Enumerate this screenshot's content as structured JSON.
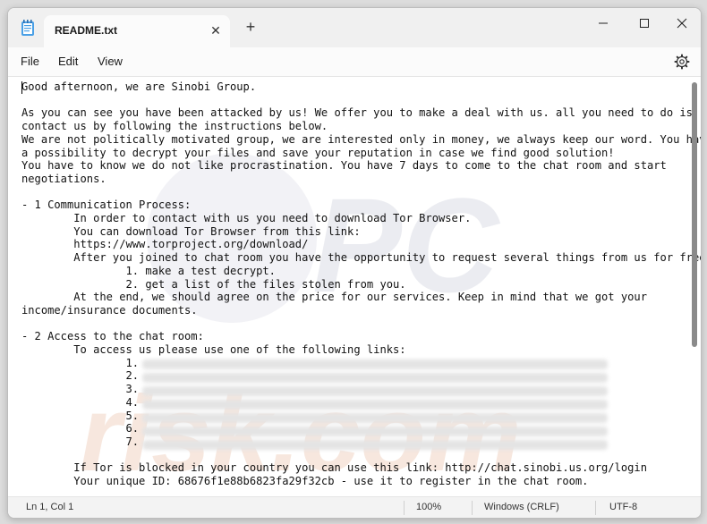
{
  "tab": {
    "title": "README.txt"
  },
  "menu": [
    "File",
    "Edit",
    "View"
  ],
  "icons": {
    "app": "notepad-icon",
    "close_tab": "close-icon",
    "new_tab": "plus-icon",
    "minimize": "minimize-icon",
    "maximize": "maximize-icon",
    "close_window": "close-icon",
    "settings": "gear-icon"
  },
  "document": {
    "text": "Good afternoon, we are Sinobi Group.\n\nAs you can see you have been attacked by us! We offer you to make a deal with us. all you need to do is\ncontact us by following the instructions below.\nWe are not politically motivated group, we are interested only in money, we always keep our word. You have\na possibility to decrypt your files and save your reputation in case we find good solution!\nYou have to know we do not like procrastination. You have 7 days to come to the chat room and start\nnegotiations.\n\n- 1 Communication Process:\n\tIn order to contact with us you need to download Tor Browser.\n\tYou can download Tor Browser from this link:\n\thttps://www.torproject.org/download/\n\tAfter you joined to chat room you have the opportunity to request several things from us for free:\n\t\t1. make a test decrypt.\n\t\t2. get a list of the files stolen from you.\n\tAt the end, we should agree on the price for our services. Keep in mind that we got your\nincome/insurance documents.\n\n- 2 Access to the chat room:\n\tTo access us please use one of the following links:\n\t\t1.\n\t\t2.\n\t\t3.\n\t\t4.\n\t\t5.\n\t\t6.\n\t\t7.\n\n\tIf Tor is blocked in your country you can use this link: http://chat.sinobi.us.org/login\n\tYour unique ID: 68676f1e88b6823fa29f32cb - use it to register in the chat room."
  },
  "watermark": "PCrisk.com",
  "status": {
    "position": "Ln 1, Col 1",
    "zoom": "100%",
    "line_ending": "Windows (CRLF)",
    "encoding": "UTF-8"
  }
}
